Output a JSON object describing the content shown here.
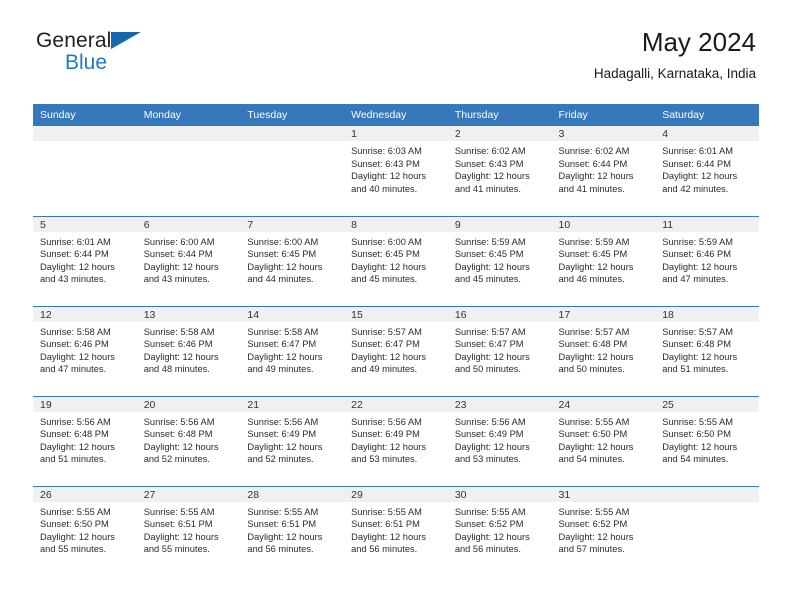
{
  "logo": {
    "word1": "General",
    "word2": "Blue",
    "triangle_color": "#1668ad",
    "text_color": "#231f20",
    "blue_color": "#1f7ac4"
  },
  "header": {
    "title": "May 2024",
    "subtitle": "Hadagalli, Karnataka, India"
  },
  "theme": {
    "header_bg": "#3777bc",
    "daynum_bg": "#f0f0f0",
    "grid_line": "#3777bc",
    "text": "#2b2b2b"
  },
  "weekdays": [
    "Sunday",
    "Monday",
    "Tuesday",
    "Wednesday",
    "Thursday",
    "Friday",
    "Saturday"
  ],
  "weeks": [
    [
      {
        "day": "",
        "lines": []
      },
      {
        "day": "",
        "lines": []
      },
      {
        "day": "",
        "lines": []
      },
      {
        "day": "1",
        "lines": [
          "Sunrise: 6:03 AM",
          "Sunset: 6:43 PM",
          "Daylight: 12 hours",
          "and 40 minutes."
        ]
      },
      {
        "day": "2",
        "lines": [
          "Sunrise: 6:02 AM",
          "Sunset: 6:43 PM",
          "Daylight: 12 hours",
          "and 41 minutes."
        ]
      },
      {
        "day": "3",
        "lines": [
          "Sunrise: 6:02 AM",
          "Sunset: 6:44 PM",
          "Daylight: 12 hours",
          "and 41 minutes."
        ]
      },
      {
        "day": "4",
        "lines": [
          "Sunrise: 6:01 AM",
          "Sunset: 6:44 PM",
          "Daylight: 12 hours",
          "and 42 minutes."
        ]
      }
    ],
    [
      {
        "day": "5",
        "lines": [
          "Sunrise: 6:01 AM",
          "Sunset: 6:44 PM",
          "Daylight: 12 hours",
          "and 43 minutes."
        ]
      },
      {
        "day": "6",
        "lines": [
          "Sunrise: 6:00 AM",
          "Sunset: 6:44 PM",
          "Daylight: 12 hours",
          "and 43 minutes."
        ]
      },
      {
        "day": "7",
        "lines": [
          "Sunrise: 6:00 AM",
          "Sunset: 6:45 PM",
          "Daylight: 12 hours",
          "and 44 minutes."
        ]
      },
      {
        "day": "8",
        "lines": [
          "Sunrise: 6:00 AM",
          "Sunset: 6:45 PM",
          "Daylight: 12 hours",
          "and 45 minutes."
        ]
      },
      {
        "day": "9",
        "lines": [
          "Sunrise: 5:59 AM",
          "Sunset: 6:45 PM",
          "Daylight: 12 hours",
          "and 45 minutes."
        ]
      },
      {
        "day": "10",
        "lines": [
          "Sunrise: 5:59 AM",
          "Sunset: 6:45 PM",
          "Daylight: 12 hours",
          "and 46 minutes."
        ]
      },
      {
        "day": "11",
        "lines": [
          "Sunrise: 5:59 AM",
          "Sunset: 6:46 PM",
          "Daylight: 12 hours",
          "and 47 minutes."
        ]
      }
    ],
    [
      {
        "day": "12",
        "lines": [
          "Sunrise: 5:58 AM",
          "Sunset: 6:46 PM",
          "Daylight: 12 hours",
          "and 47 minutes."
        ]
      },
      {
        "day": "13",
        "lines": [
          "Sunrise: 5:58 AM",
          "Sunset: 6:46 PM",
          "Daylight: 12 hours",
          "and 48 minutes."
        ]
      },
      {
        "day": "14",
        "lines": [
          "Sunrise: 5:58 AM",
          "Sunset: 6:47 PM",
          "Daylight: 12 hours",
          "and 49 minutes."
        ]
      },
      {
        "day": "15",
        "lines": [
          "Sunrise: 5:57 AM",
          "Sunset: 6:47 PM",
          "Daylight: 12 hours",
          "and 49 minutes."
        ]
      },
      {
        "day": "16",
        "lines": [
          "Sunrise: 5:57 AM",
          "Sunset: 6:47 PM",
          "Daylight: 12 hours",
          "and 50 minutes."
        ]
      },
      {
        "day": "17",
        "lines": [
          "Sunrise: 5:57 AM",
          "Sunset: 6:48 PM",
          "Daylight: 12 hours",
          "and 50 minutes."
        ]
      },
      {
        "day": "18",
        "lines": [
          "Sunrise: 5:57 AM",
          "Sunset: 6:48 PM",
          "Daylight: 12 hours",
          "and 51 minutes."
        ]
      }
    ],
    [
      {
        "day": "19",
        "lines": [
          "Sunrise: 5:56 AM",
          "Sunset: 6:48 PM",
          "Daylight: 12 hours",
          "and 51 minutes."
        ]
      },
      {
        "day": "20",
        "lines": [
          "Sunrise: 5:56 AM",
          "Sunset: 6:48 PM",
          "Daylight: 12 hours",
          "and 52 minutes."
        ]
      },
      {
        "day": "21",
        "lines": [
          "Sunrise: 5:56 AM",
          "Sunset: 6:49 PM",
          "Daylight: 12 hours",
          "and 52 minutes."
        ]
      },
      {
        "day": "22",
        "lines": [
          "Sunrise: 5:56 AM",
          "Sunset: 6:49 PM",
          "Daylight: 12 hours",
          "and 53 minutes."
        ]
      },
      {
        "day": "23",
        "lines": [
          "Sunrise: 5:56 AM",
          "Sunset: 6:49 PM",
          "Daylight: 12 hours",
          "and 53 minutes."
        ]
      },
      {
        "day": "24",
        "lines": [
          "Sunrise: 5:55 AM",
          "Sunset: 6:50 PM",
          "Daylight: 12 hours",
          "and 54 minutes."
        ]
      },
      {
        "day": "25",
        "lines": [
          "Sunrise: 5:55 AM",
          "Sunset: 6:50 PM",
          "Daylight: 12 hours",
          "and 54 minutes."
        ]
      }
    ],
    [
      {
        "day": "26",
        "lines": [
          "Sunrise: 5:55 AM",
          "Sunset: 6:50 PM",
          "Daylight: 12 hours",
          "and 55 minutes."
        ]
      },
      {
        "day": "27",
        "lines": [
          "Sunrise: 5:55 AM",
          "Sunset: 6:51 PM",
          "Daylight: 12 hours",
          "and 55 minutes."
        ]
      },
      {
        "day": "28",
        "lines": [
          "Sunrise: 5:55 AM",
          "Sunset: 6:51 PM",
          "Daylight: 12 hours",
          "and 56 minutes."
        ]
      },
      {
        "day": "29",
        "lines": [
          "Sunrise: 5:55 AM",
          "Sunset: 6:51 PM",
          "Daylight: 12 hours",
          "and 56 minutes."
        ]
      },
      {
        "day": "30",
        "lines": [
          "Sunrise: 5:55 AM",
          "Sunset: 6:52 PM",
          "Daylight: 12 hours",
          "and 56 minutes."
        ]
      },
      {
        "day": "31",
        "lines": [
          "Sunrise: 5:55 AM",
          "Sunset: 6:52 PM",
          "Daylight: 12 hours",
          "and 57 minutes."
        ]
      },
      {
        "day": "",
        "lines": []
      }
    ]
  ]
}
